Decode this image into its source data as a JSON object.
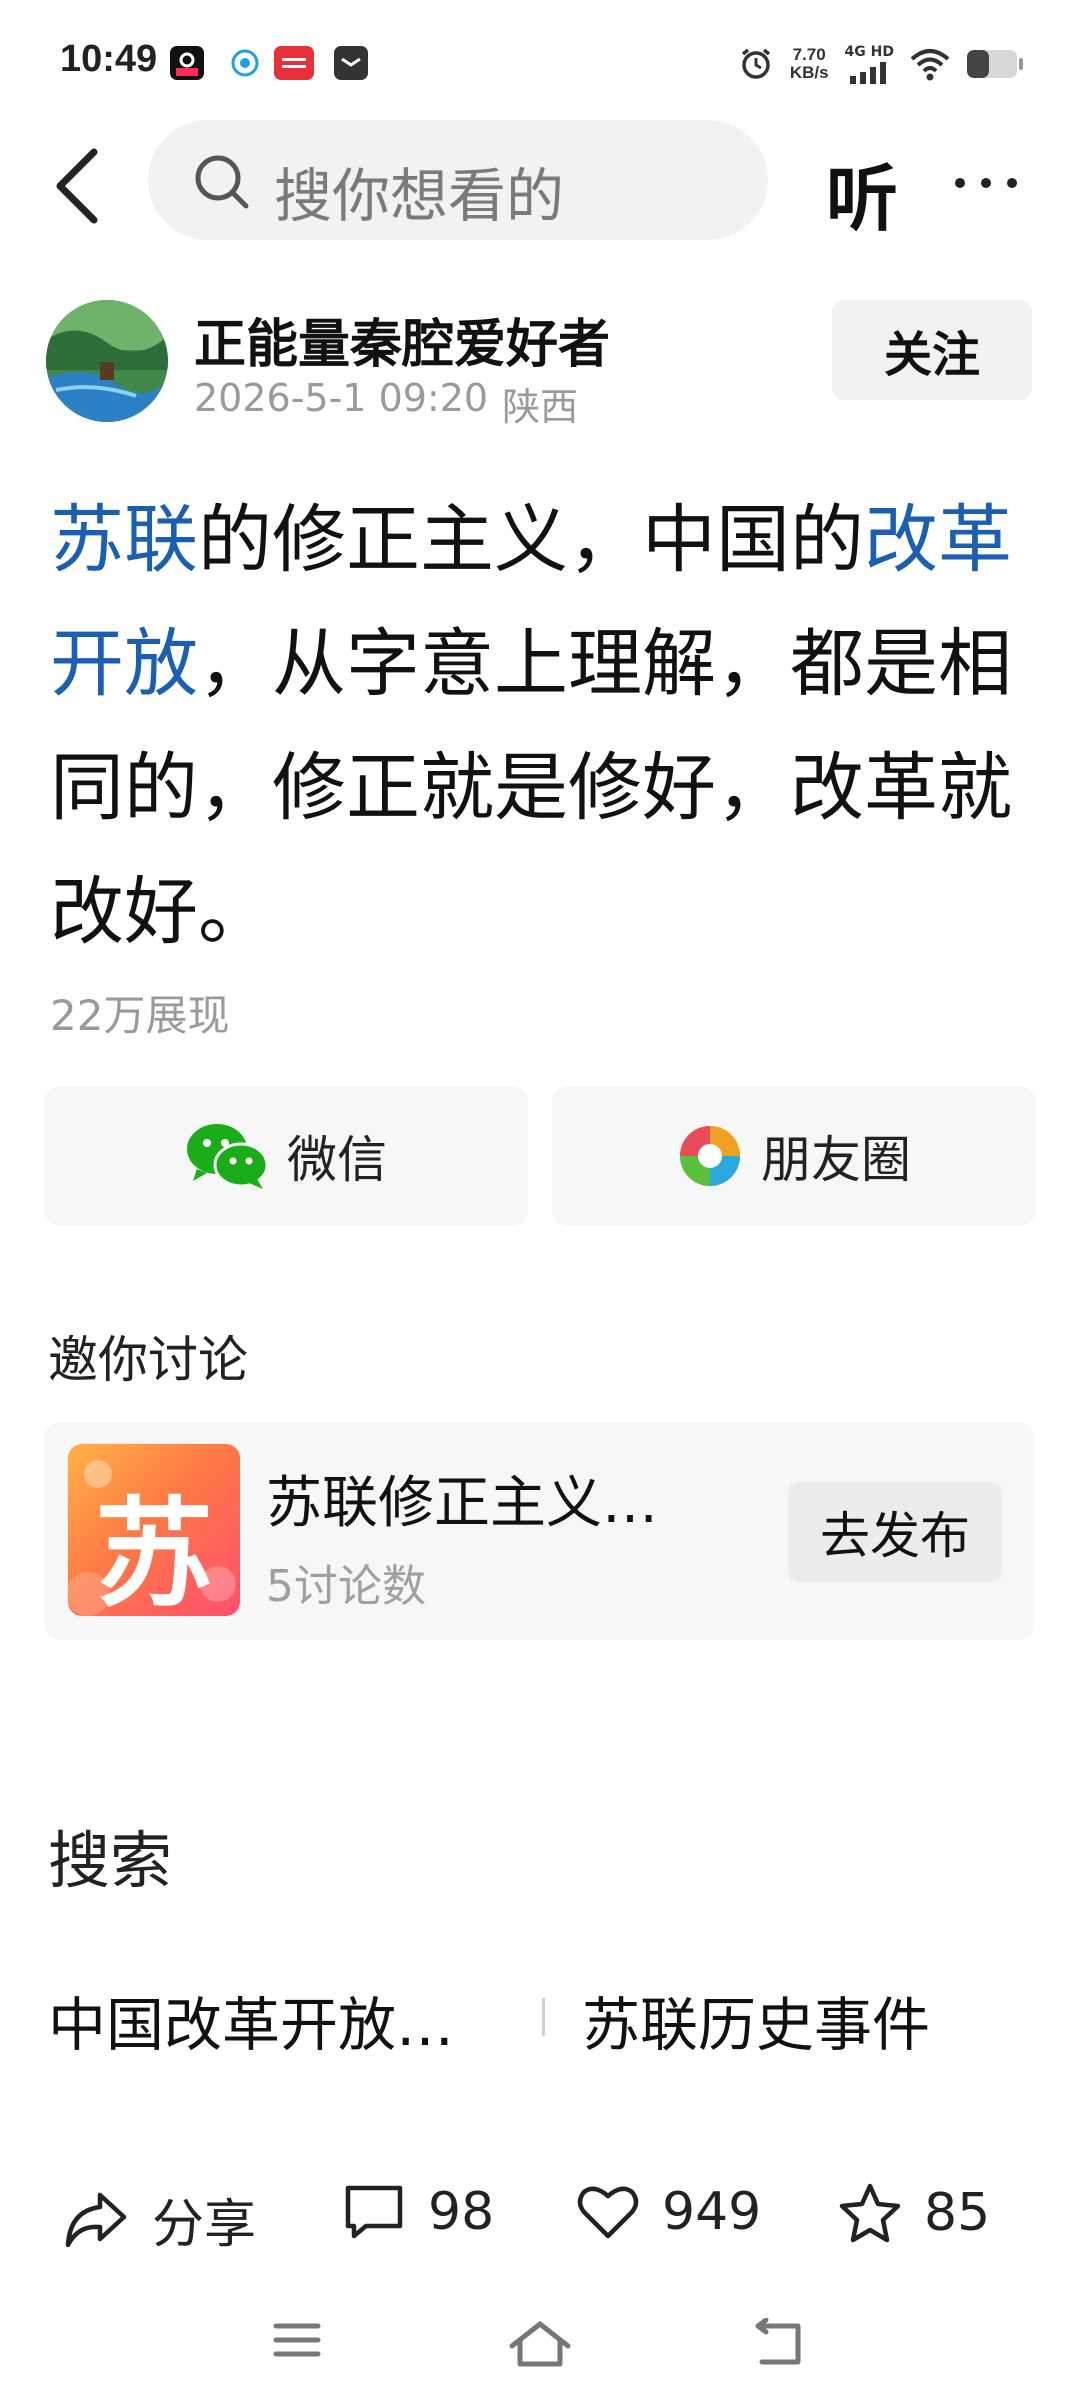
{
  "status_bar": {
    "time": "10:49",
    "net_speed_value": "7.70",
    "net_speed_unit": "KB/s",
    "network_label": "4G HD"
  },
  "nav": {
    "search_placeholder": "搜你想看的",
    "listen_label": "听"
  },
  "author": {
    "name": "正能量秦腔爱好者",
    "date": "2026-5-1 09:20",
    "location": "陕西",
    "follow_label": "关注"
  },
  "post": {
    "link1": "苏联",
    "text1": "的修正主义，中国的",
    "link2": "改革开放",
    "text2": "，从字意上理解，都是相同的，修正就是修好，改革就改好。",
    "views": "22万展现"
  },
  "share": {
    "wechat_label": "微信",
    "moments_label": "朋友圈"
  },
  "discussion": {
    "section_title": "邀你讨论",
    "thumb_char": "苏",
    "topic_title": "苏联修正主义…",
    "topic_count": "5讨论数",
    "publish_label": "去发布"
  },
  "search_section": {
    "title": "搜索",
    "items": [
      "中国改革开放…",
      "苏联历史事件"
    ]
  },
  "actions": {
    "share_label": "分享",
    "comments": "98",
    "likes": "949",
    "favorites": "85"
  },
  "colors": {
    "link": "#1a5fb4",
    "wechat_green": "#1aad19",
    "muted": "#9a9a9a"
  }
}
